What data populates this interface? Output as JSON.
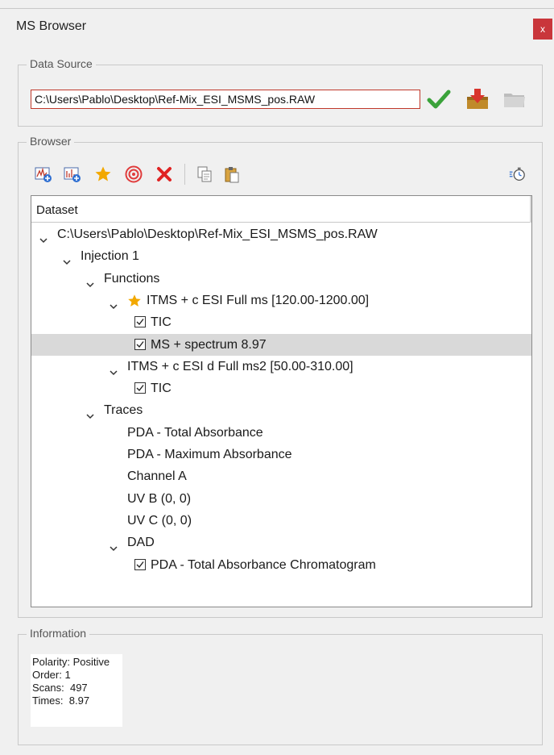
{
  "window": {
    "title": "MS Browser",
    "close_label": "x"
  },
  "data_source": {
    "legend": "Data Source",
    "path_value": "C:\\Users\\Pablo\\Desktop\\Ref-Mix_ESI_MSMS_pos.RAW",
    "icons": [
      "check-icon",
      "download-icon",
      "folder-icon"
    ]
  },
  "browser": {
    "legend": "Browser",
    "toolbar_icons": [
      "add-chromatogram-icon",
      "add-spectrum-icon",
      "star-icon",
      "target-icon",
      "delete-icon",
      "copy-icon",
      "paste-icon",
      "timer-icon"
    ],
    "tree": {
      "header": "Dataset",
      "rows": [
        {
          "label": "C:\\Users\\Pablo\\Desktop\\Ref-Mix_ESI_MSMS_pos.RAW",
          "level": 0,
          "expandable": true
        },
        {
          "label": "Injection 1",
          "level": 1,
          "expandable": true
        },
        {
          "label": "Functions",
          "level": 2,
          "expandable": true
        },
        {
          "label": "ITMS + c ESI Full ms [120.00-1200.00]",
          "level": 3,
          "expandable": true,
          "starred": true
        },
        {
          "label": "TIC",
          "level": 4,
          "checked": true
        },
        {
          "label": "MS + spectrum 8.97",
          "level": 4,
          "checked": true,
          "selected": true
        },
        {
          "label": "ITMS + c ESI d Full ms2 [50.00-310.00]",
          "level": 3,
          "expandable": true
        },
        {
          "label": "TIC",
          "level": 4,
          "checked": true
        },
        {
          "label": "Traces",
          "level": 2,
          "expandable": true
        },
        {
          "label": "PDA - Total Absorbance",
          "level": 3
        },
        {
          "label": "PDA - Maximum Absorbance",
          "level": 3
        },
        {
          "label": "Channel A",
          "level": 3
        },
        {
          "label": "UV B (0, 0)",
          "level": 3
        },
        {
          "label": "UV C (0, 0)",
          "level": 3
        },
        {
          "label": "DAD",
          "level": 3,
          "expandable": true
        },
        {
          "label": "PDA - Total Absorbance Chromatogram",
          "level": 4,
          "checked": true
        }
      ]
    }
  },
  "information": {
    "legend": "Information",
    "lines": [
      "Polarity: Positive",
      "Order: 1",
      "Scans:  497",
      "Times:  8.97"
    ]
  },
  "colors": {
    "accent_red": "#c9363b",
    "check_green": "#3aa23a",
    "star_gold": "#f2a800"
  }
}
